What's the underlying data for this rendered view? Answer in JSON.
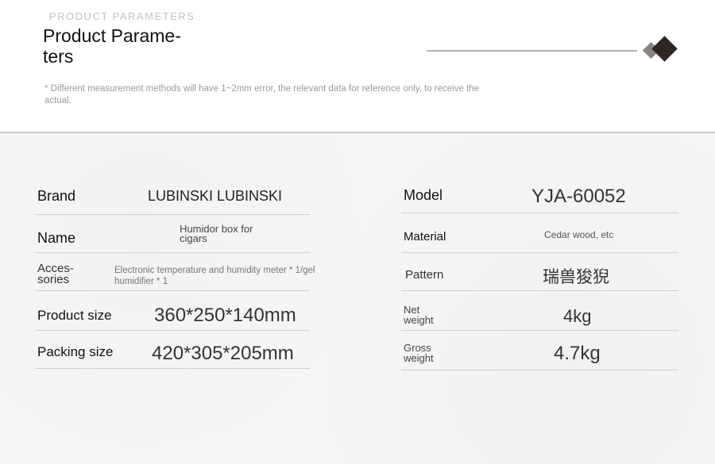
{
  "header": {
    "eyebrow": "PRODUCT PARAMETERS",
    "title": "Product Parame-\nters",
    "note": "* Different measurement methods will have 1~2mm error, the relevant data for reference only, to receive the actual."
  },
  "left": [
    {
      "label": "Brand",
      "value": "LUBINSKI LUBINSKI"
    },
    {
      "label": "Name",
      "value": "Humidor box for cigars"
    },
    {
      "label": "Acces-\nsories",
      "value": "Electronic temperature and humidity meter * 1/gel humidifier * 1"
    },
    {
      "label": "Product size",
      "value": "360*250*140mm"
    },
    {
      "label": "Packing size",
      "value": "420*305*205mm"
    }
  ],
  "right": [
    {
      "label": "Model",
      "value": "YJA-60052"
    },
    {
      "label": "Material",
      "value": "Cedar wood, etc"
    },
    {
      "label": "Pattern",
      "value": "瑞兽狻猊"
    },
    {
      "label": "Net\nweight",
      "value": "4kg"
    },
    {
      "label": "Gross\nweight",
      "value": "4.7kg"
    }
  ],
  "colors": {
    "diamond_dark": "#2f2420",
    "diamond_light": "#8a8480",
    "accent_line": "#b0b0b0"
  }
}
